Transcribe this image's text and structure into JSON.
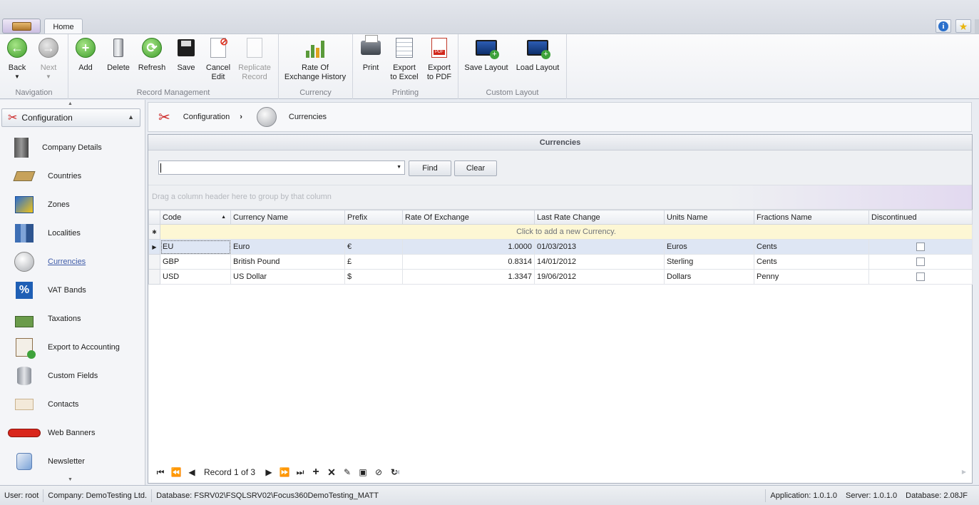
{
  "tabs": {
    "home": "Home"
  },
  "ribbon": {
    "navigation": {
      "label": "Navigation",
      "back": "Back",
      "next": "Next"
    },
    "record_management": {
      "label": "Record Management",
      "add": "Add",
      "delete": "Delete",
      "refresh": "Refresh",
      "save": "Save",
      "cancel_edit_1": "Cancel",
      "cancel_edit_2": "Edit",
      "replicate_1": "Replicate",
      "replicate_2": "Record"
    },
    "currency": {
      "label": "Currency",
      "rate_history_1": "Rate Of",
      "rate_history_2": "Exchange History"
    },
    "printing": {
      "label": "Printing",
      "print": "Print",
      "export_excel_1": "Export",
      "export_excel_2": "to Excel",
      "export_pdf_1": "Export",
      "export_pdf_2": "to PDF",
      "pdf_badge": "PDF"
    },
    "custom_layout": {
      "label": "Custom Layout",
      "save_layout": "Save Layout",
      "load_layout": "Load Layout"
    }
  },
  "sidebar": {
    "header": "Configuration",
    "items": [
      {
        "label": "Company Details",
        "icon": "building-icon"
      },
      {
        "label": "Countries",
        "icon": "map-icon"
      },
      {
        "label": "Zones",
        "icon": "zone-map-icon"
      },
      {
        "label": "Localities",
        "icon": "city-icon"
      },
      {
        "label": "Currencies",
        "icon": "coin-icon"
      },
      {
        "label": "VAT Bands",
        "icon": "percent-icon"
      },
      {
        "label": "Taxations",
        "icon": "tax-icon"
      },
      {
        "label": "Export to Accounting",
        "icon": "export-icon"
      },
      {
        "label": "Custom Fields",
        "icon": "database-icon"
      },
      {
        "label": "Contacts",
        "icon": "envelope-icon"
      },
      {
        "label": "Web Banners",
        "icon": "banner-icon"
      },
      {
        "label": "Newsletter",
        "icon": "newsletter-icon"
      }
    ]
  },
  "breadcrumb": {
    "root": "Configuration",
    "current": "Currencies"
  },
  "grid": {
    "title": "Currencies",
    "find": "Find",
    "clear": "Clear",
    "group_hint": "Drag a column header here to group by that column",
    "new_row_hint": "Click to add a new Currency.",
    "columns": [
      "Code",
      "Currency Name",
      "Prefix",
      "Rate Of Exchange",
      "Last Rate Change",
      "Units Name",
      "Fractions Name",
      "Discontinued"
    ],
    "rows": [
      [
        "EU",
        "Euro",
        "€",
        "1.0000",
        "01/03/2013",
        "Euros",
        "Cents",
        ""
      ],
      [
        "GBP",
        "British Pound",
        "£",
        "0.8314",
        "14/01/2012",
        "Sterling",
        "Cents",
        ""
      ],
      [
        "USD",
        "US Dollar",
        "$",
        "1.3347",
        "19/06/2012",
        "Dollars",
        "Penny",
        ""
      ]
    ],
    "record_text": "Record 1 of 3"
  },
  "status": {
    "user": "User: root",
    "company": "Company: DemoTesting Ltd.",
    "database": "Database: FSRV02\\FSQLSRV02\\Focus360DemoTesting_MATT",
    "application": "Application: 1.0.1.0",
    "server": "Server: 1.0.1.0",
    "db_version": "Database: 2.08JF"
  },
  "colors": {
    "accent_link": "#3d5aa8",
    "new_row_bg": "#fdf7d4",
    "selected_row_bg": "#dee6f4"
  }
}
